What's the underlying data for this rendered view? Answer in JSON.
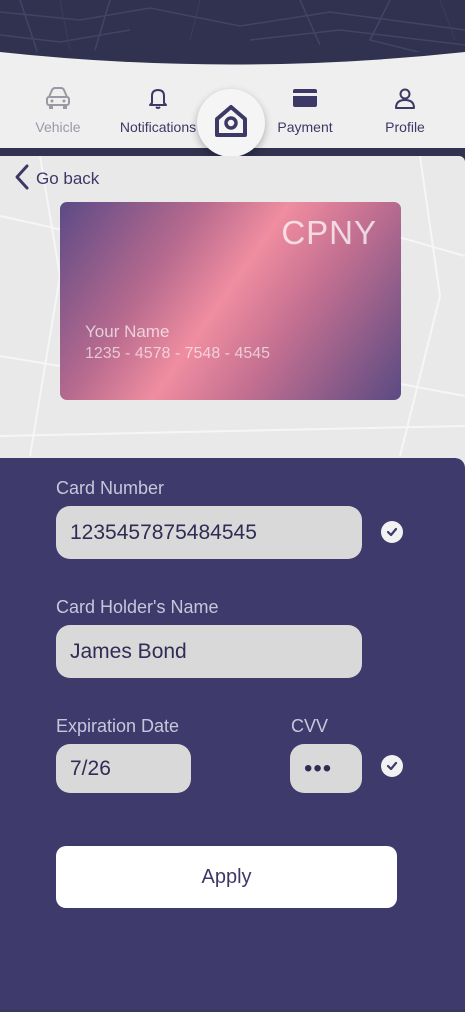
{
  "nav": {
    "vehicle_label": "Vehicle",
    "notifications_label": "Notifications",
    "payment_label": "Payment",
    "profile_label": "Profile"
  },
  "back": {
    "label": "Go back"
  },
  "card": {
    "brand": "CPNY",
    "holder_placeholder": "Your Name",
    "number_display": "1235 - 4578 - 7548 - 4545"
  },
  "form": {
    "card_number_label": "Card Number",
    "card_number_value": "1235457875484545",
    "holder_label": "Card Holder's Name",
    "holder_value": "James Bond",
    "expiration_label": "Expiration Date",
    "expiration_value": "7/26",
    "cvv_label": "CVV",
    "cvv_value": "•••",
    "apply_label": "Apply"
  },
  "colors": {
    "primary": "#3f3a6c",
    "accent_pink": "#f08da0",
    "field_bg": "#d9d9d9"
  }
}
